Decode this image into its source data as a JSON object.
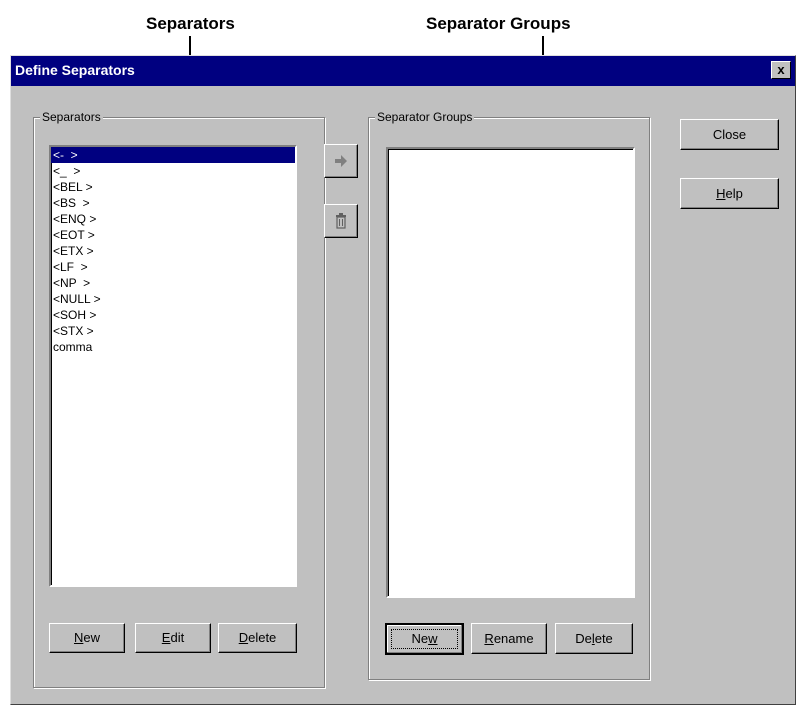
{
  "callouts": {
    "separators": "Separators",
    "separator_groups": "Separator Groups"
  },
  "window": {
    "title": "Define Separators",
    "close_glyph": "x"
  },
  "separators_panel": {
    "label": "Separators",
    "items": [
      "<-  >",
      "<_  >",
      "<BEL >",
      "<BS  >",
      "<ENQ >",
      "<EOT >",
      "<ETX >",
      "<LF  >",
      "<NP  >",
      "<NULL >",
      "<SOH >",
      "<STX >",
      "comma"
    ],
    "selected_index": 0,
    "buttons": {
      "new": {
        "pre": "",
        "accel": "N",
        "post": "ew"
      },
      "edit": {
        "pre": "",
        "accel": "E",
        "post": "dit"
      },
      "delete": {
        "pre": "",
        "accel": "D",
        "post": "elete"
      }
    }
  },
  "middle_buttons": {
    "add_icon": "arrow-right",
    "remove_icon": "trash-can"
  },
  "groups_panel": {
    "label": "Separator Groups",
    "items": [],
    "buttons": {
      "new": {
        "pre": "Ne",
        "accel": "w",
        "post": ""
      },
      "rename": {
        "pre": "",
        "accel": "R",
        "post": "ename"
      },
      "delete": {
        "pre": "De",
        "accel": "l",
        "post": "ete"
      }
    }
  },
  "side_buttons": {
    "close": "Close",
    "help": {
      "pre": "",
      "accel": "H",
      "post": "elp"
    }
  },
  "colors": {
    "face": "#c0c0c0",
    "titlebar": "#000080",
    "selection": "#000080"
  }
}
